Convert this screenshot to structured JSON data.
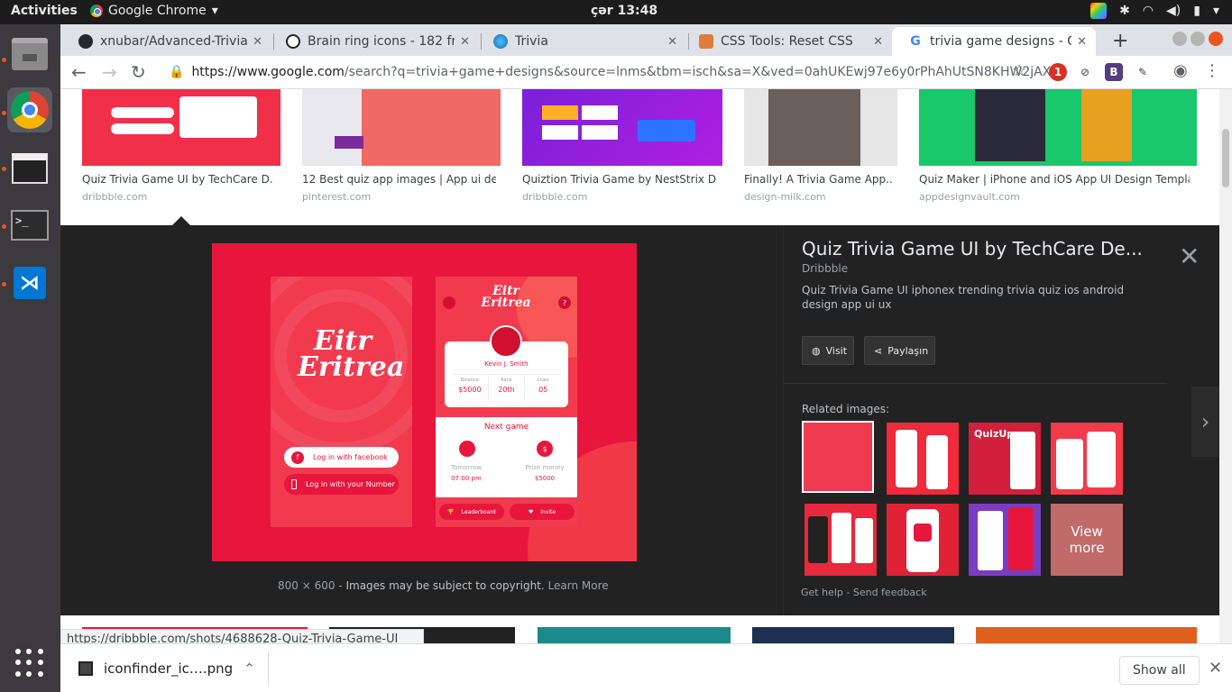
{
  "system": {
    "activities": "Activities",
    "app_name": "Google Chrome",
    "clock": "çər 13:48"
  },
  "tabs": [
    {
      "title": "xnubar/Advanced-Trivia",
      "icon": "github-icon"
    },
    {
      "title": "Brain ring icons - 182 fre",
      "icon": "brain-icon"
    },
    {
      "title": "Trivia",
      "icon": "trivia-icon"
    },
    {
      "title": "CSS Tools: Reset CSS",
      "icon": "css-tools-icon"
    },
    {
      "title": "trivia game designs - Go",
      "icon": "google-icon"
    }
  ],
  "address_bar": {
    "host": "https://www.google.com",
    "path": "/search?q=trivia+game+designs&source=lnms&tbm=isch&sa=X&ved=0ahUKEwj97e6y0rPhAhUtSN8KHW2jAXcQ_A..."
  },
  "extensions": [
    {
      "name": "opera-ext",
      "label": "1",
      "color": "#d93025"
    },
    {
      "name": "block-ext",
      "label": "⊘",
      "color": "#5f6368"
    },
    {
      "name": "bootstrap-ext",
      "label": "B",
      "color": "#563d7c"
    },
    {
      "name": "eyedropper-ext",
      "label": "✎",
      "color": "#3c4043"
    }
  ],
  "results": [
    {
      "title": "Quiz Trivia Game UI by TechCare D...",
      "source": "dribbble.com",
      "color": "#f03048"
    },
    {
      "title": "12 Best quiz app images | App ui de...",
      "source": "pinterest.com",
      "color": "#ef6a64"
    },
    {
      "title": "Quiztion Trivia Game by NestStrix D...",
      "source": "dribbble.com",
      "color": "#7a1fd8"
    },
    {
      "title": "Finally! A Trivia Game App...",
      "source": "design-milk.com",
      "color": "#8c8c8c"
    },
    {
      "title": "Quiz Maker | iPhone and iOS App UI Design Templa...",
      "source": "appdesignvault.com",
      "color": "#18c86a"
    }
  ],
  "preview": {
    "logo_line1": "Eitr",
    "logo_line2": "Eritrea",
    "login_facebook": "Log in with facebook",
    "login_number": "Log in with your Number",
    "user_name": "Kevin J. Smith",
    "stats": [
      {
        "label": "Balance",
        "value": "$5000"
      },
      {
        "label": "Rank",
        "value": "20th"
      },
      {
        "label": "Lives",
        "value": "05"
      }
    ],
    "next_game": "Next game",
    "tomorrow": "Tomorrow",
    "time": "07:00 pm",
    "prize_label": "Prize money",
    "prize": "$5000",
    "leaderboard": "Leaderboard",
    "invite": "Invite"
  },
  "info": {
    "title": "Quiz Trivia Game UI by TechCare De...",
    "site": "Dribbble",
    "description": "Quiz Trivia Game UI iphonex trending trivia quiz ios android design app ui ux",
    "visit": "Visit",
    "share": "Paylaşın",
    "related_label": "Related images:",
    "view_more": "View more",
    "dimensions": "800 × 600",
    "copyright": "Images may be subject to copyright.",
    "learn_more": "Learn More",
    "get_help": "Get help",
    "send_feedback": "Send feedback"
  },
  "related_colors": [
    "#f03a50",
    "#ee2a3c",
    "#d21f3c",
    "#f23a4a",
    "#e8283c",
    "#e02236",
    "#7a3dc2",
    "#d84b5a"
  ],
  "status_url": "https://dribbble.com/shots/4688628-Quiz-Trivia-Game-UI",
  "download": {
    "file": "iconfinder_ic….png",
    "show_all": "Show all"
  }
}
